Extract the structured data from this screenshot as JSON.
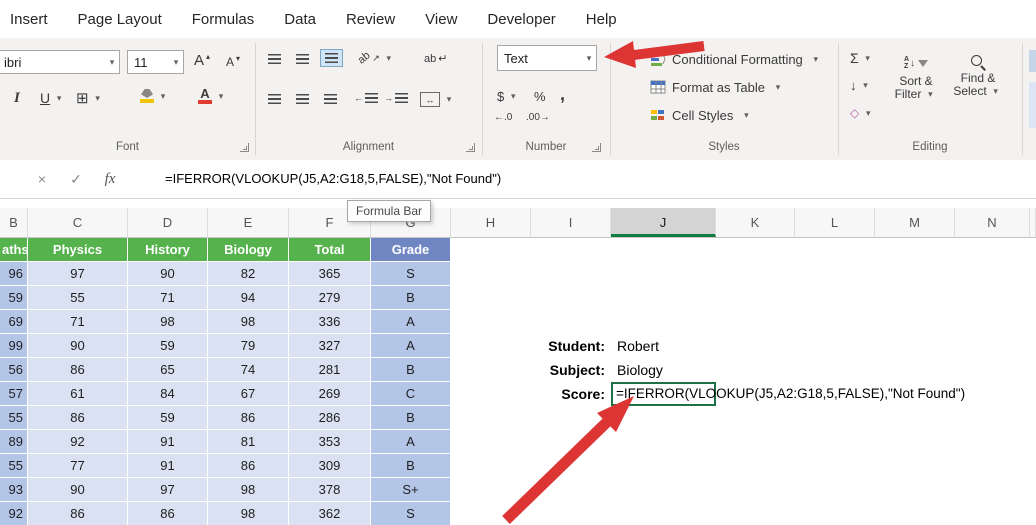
{
  "menubar": {
    "tabs": [
      "Insert",
      "Page Layout",
      "Formulas",
      "Data",
      "Review",
      "View",
      "Developer",
      "Help"
    ]
  },
  "ribbon": {
    "font": {
      "group_label": "Font",
      "font_name": "ibri",
      "font_size": "11"
    },
    "alignment": {
      "group_label": "Alignment"
    },
    "number": {
      "group_label": "Number",
      "format_selected": "Text"
    },
    "styles": {
      "group_label": "Styles",
      "items": [
        "Conditional Formatting",
        "Format as Table",
        "Cell Styles"
      ]
    },
    "editing": {
      "group_label": "Editing",
      "sort_filter_lines": [
        "Sort &",
        "Filter"
      ],
      "find_select_lines": [
        "Find &",
        "Select"
      ]
    }
  },
  "icons": {
    "dropdown": "▾",
    "up_tri": "▴",
    "cancel": "×",
    "enter": "✓",
    "function": "fx",
    "italic": "I",
    "underline": "U",
    "borders": "⊞",
    "autosum": "Σ",
    "currency": "$",
    "percent": "%",
    "comma": ",",
    "fill_down": "↓",
    "clear": "◇",
    "grow_font": "A",
    "shrink_font": "A",
    "font_color": "A",
    "orientation": "ab",
    "diag_arrow": "↗",
    "wrap_text": "ab",
    "return_arrow": "↵",
    "merge_center": "↔",
    "increase_decimal": "←.0",
    "decrease_decimal": ".00→",
    "sort_a": "A",
    "sort_z": "Z",
    "left_arrow": "←",
    "right_arrow": "→"
  },
  "formula_bar": {
    "formula": "=IFERROR(VLOOKUP(J5,A2:G18,5,FALSE),\"Not Found\")",
    "tooltip": "Formula Bar"
  },
  "sheet": {
    "column_headers": [
      "B",
      "C",
      "D",
      "E",
      "F",
      "G",
      "H",
      "I",
      "J",
      "K",
      "L",
      "M",
      "N"
    ],
    "selected_column": "J",
    "table": {
      "headers": [
        "aths",
        "Physics",
        "History",
        "Biology",
        "Total",
        "Grade"
      ],
      "rows": [
        [
          "96",
          "97",
          "90",
          "82",
          "365",
          "S"
        ],
        [
          "59",
          "55",
          "71",
          "94",
          "279",
          "B"
        ],
        [
          "69",
          "71",
          "98",
          "98",
          "336",
          "A"
        ],
        [
          "99",
          "90",
          "59",
          "79",
          "327",
          "A"
        ],
        [
          "56",
          "86",
          "65",
          "74",
          "281",
          "B"
        ],
        [
          "57",
          "61",
          "84",
          "67",
          "269",
          "C"
        ],
        [
          "55",
          "86",
          "59",
          "86",
          "286",
          "B"
        ],
        [
          "89",
          "92",
          "91",
          "81",
          "353",
          "A"
        ],
        [
          "55",
          "77",
          "91",
          "86",
          "309",
          "B"
        ],
        [
          "93",
          "90",
          "97",
          "98",
          "378",
          "S+"
        ],
        [
          "92",
          "86",
          "86",
          "98",
          "362",
          "S"
        ]
      ]
    },
    "lookup": {
      "student_label": "Student:",
      "student_value": "Robert",
      "subject_label": "Subject:",
      "subject_value": "Biology",
      "score_label": "Score:",
      "score_formula": "=IFERROR(VLOOKUP(J5,A2:G18,5,FALSE),\"Not Found\")"
    }
  },
  "colors": {
    "header_green": "#56b24c",
    "grade_blue": "#7086c3",
    "cell_light": "#d9e1f2",
    "cell_medium": "#b4c6e7",
    "selection_green": "#1e7145",
    "accent_green": "#107c41",
    "arrow_red": "#dd3434"
  }
}
